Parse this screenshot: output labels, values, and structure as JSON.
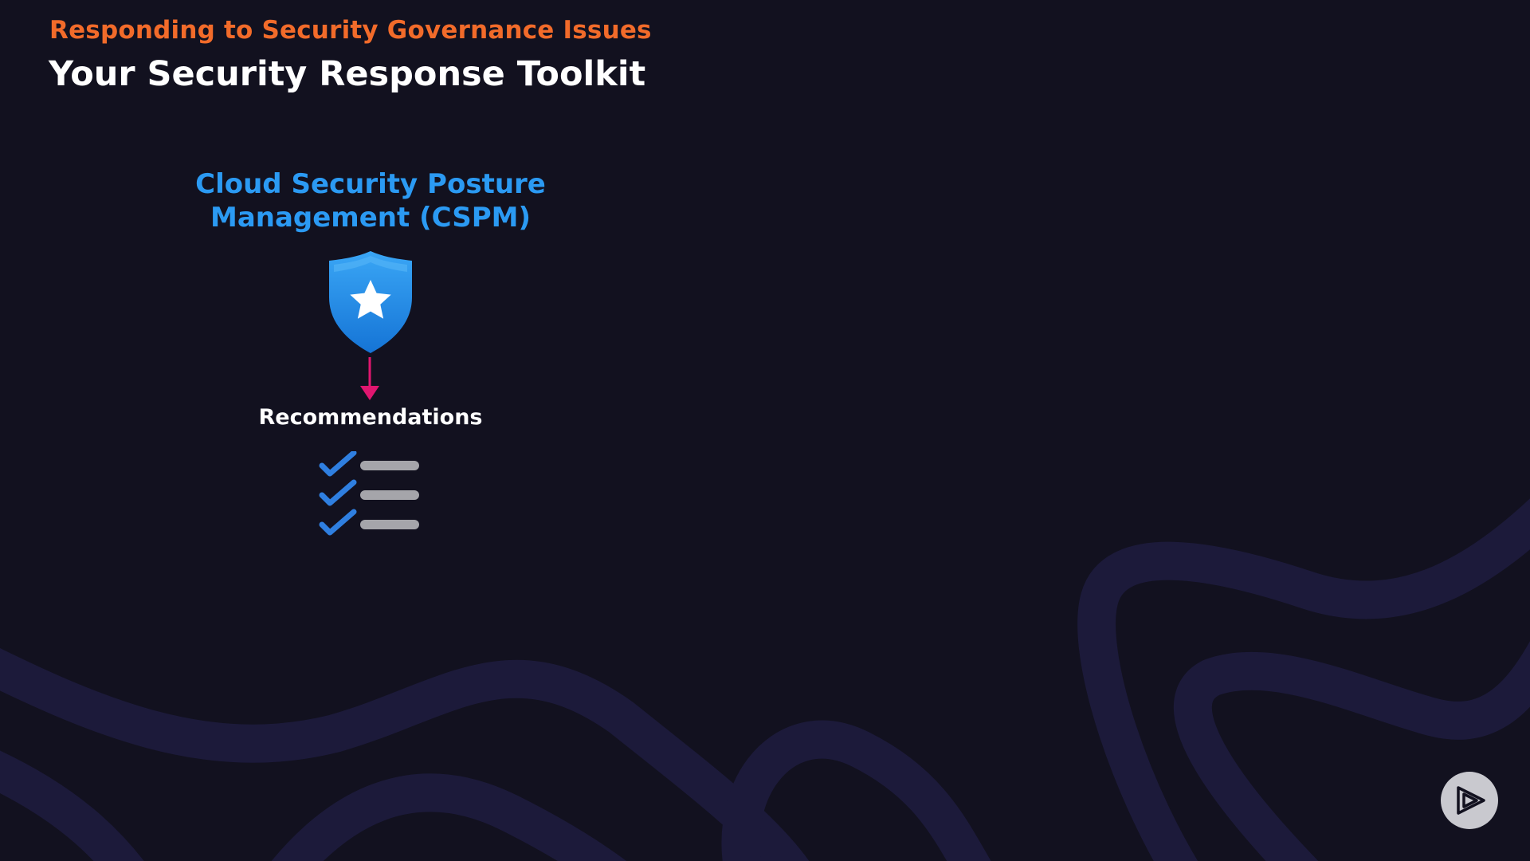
{
  "slide": {
    "subtitle": "Responding to Security Governance Issues",
    "title": "Your Security Response Toolkit"
  },
  "cspm": {
    "title_line1": "Cloud Security Posture",
    "title_line2": "Management (CSPM)",
    "icon": "shield-star-icon",
    "arrow_icon": "arrow-down-icon",
    "recommendations_label": "Recommendations",
    "checklist_icon": "checklist-icon"
  },
  "player": {
    "icon": "play-logo-icon"
  },
  "colors": {
    "background": "#12111f",
    "subtitle": "#f26b2a",
    "title": "#ffffff",
    "accent_blue": "#2b9af3",
    "arrow": "#e0166f",
    "check": "#2f7fe0",
    "list_bar": "#a5a5aa",
    "wave": "#1c1a3a"
  }
}
